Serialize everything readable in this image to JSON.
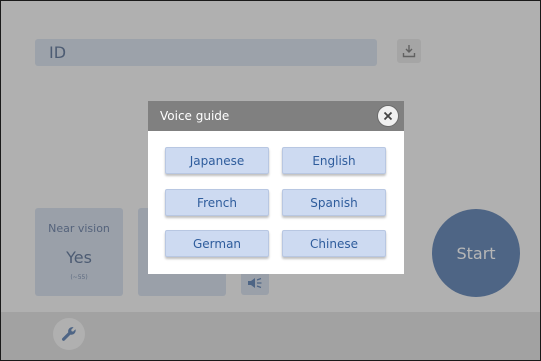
{
  "main": {
    "id_field": {
      "value": "ID"
    },
    "cards": [
      {
        "title": "Near vision",
        "value": "Yes",
        "sub": "(~55)"
      },
      {
        "title": "",
        "value": "",
        "sub": ""
      }
    ],
    "start_label": "Start"
  },
  "icons": {
    "download": "download-icon",
    "speaker": "speaker-icon",
    "wrench": "wrench-icon",
    "close": "close-icon"
  },
  "dialog": {
    "title": "Voice guide",
    "languages": [
      "Japanese",
      "English",
      "French",
      "Spanish",
      "German",
      "Chinese"
    ]
  },
  "colors": {
    "accent": "#2e5c9c",
    "button_bg": "#cddaf1",
    "field_bg": "#cbd6e6",
    "dialog_header": "#808080",
    "overlay": "rgba(110,110,110,0.5)"
  }
}
